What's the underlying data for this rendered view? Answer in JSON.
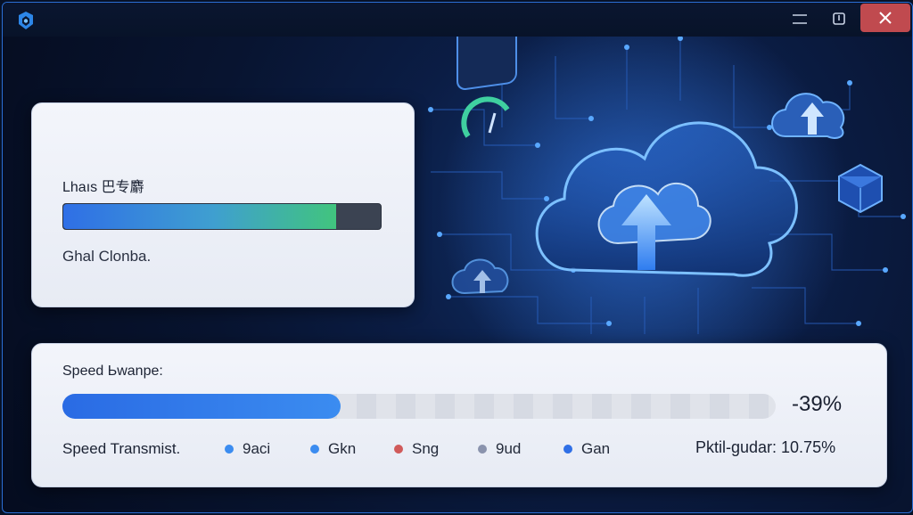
{
  "window": {
    "minimize_glyph": "—",
    "restore_glyph": "❐",
    "close_glyph": "✕"
  },
  "upload_panel": {
    "title": "Lhaıs 巴专麝",
    "progress": 0.86,
    "status": "Ghal Clonba."
  },
  "speed_panel": {
    "label": "Speed Ьwanpe:",
    "progress": 0.39,
    "percent_text": "-39%",
    "transmit_label": "Speed Transmist.",
    "legend": [
      {
        "label": "9aci",
        "color": "#3b8cf0"
      },
      {
        "label": "Gkn",
        "color": "#3b8cf0"
      },
      {
        "label": "Sng",
        "color": "#d05a5a"
      },
      {
        "label": "9ud",
        "color": "#8a93ad"
      },
      {
        "label": "Gan",
        "color": "#2f6fe6"
      }
    ],
    "packet_text": "Pktil-gudar: 10.75%"
  },
  "colors": {
    "accent": "#2f6fe6",
    "close_button": "#c04a4f",
    "background": "#081430"
  },
  "icons": [
    "app-logo-icon",
    "minimize-icon",
    "restore-icon",
    "close-icon",
    "cloud-upload-icon",
    "speed-gauge-icon",
    "cube-icon"
  ]
}
